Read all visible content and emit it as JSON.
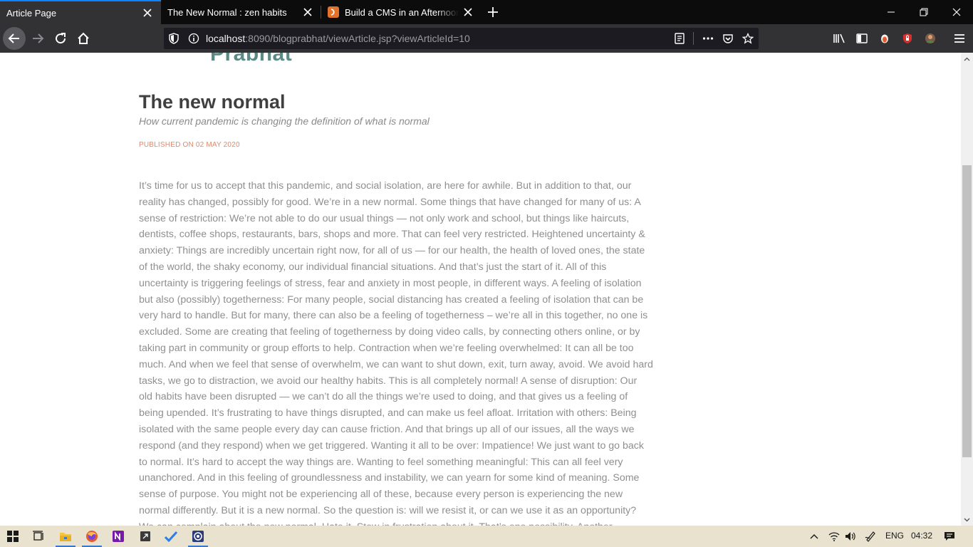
{
  "browser": {
    "tabs": [
      {
        "title": "Article Page",
        "active": true
      },
      {
        "title": "The New Normal : zen habits",
        "active": false
      },
      {
        "title": "Build a CMS in an Afternoon w",
        "active": false
      }
    ],
    "url": {
      "host": "localhost",
      "rest": ":8090/blogprabhat/viewArticle.jsp?viewArticleId=10"
    }
  },
  "page": {
    "logo_text": "Prabhat",
    "title": "The new normal",
    "subtitle": "How current pandemic is changing the definition of what is normal",
    "published": "PUBLISHED ON 02 MAY 2020",
    "body": "It’s time for us to accept that this pandemic, and social isolation, are here for awhile. But in addition to that, our reality has changed, possibly for good. We’re in a new normal. Some things that have changed for many of us: A sense of restriction: We’re not able to do our usual things — not only work and school, but things like haircuts, dentists, coffee shops, restaurants, bars, shops and more. That can feel very restricted. Heightened uncertainty & anxiety: Things are incredibly uncertain right now, for all of us — for our health, the health of loved ones, the state of the world, the shaky economy, our individual financial situations. And that’s just the start of it. All of this uncertainty is triggering feelings of stress, fear and anxiety in most people, in different ways. A feeling of isolation but also (possibly) togetherness: For many people, social distancing has created a feeling of isolation that can be very hard to handle. But for many, there can also be a feeling of togetherness – we’re all in this together, no one is excluded. Some are creating that feeling of togetherness by doing video calls, by connecting others online, or by taking part in community or group efforts to help. Contraction when we’re feeling overwhelmed: It can all be too much. And when we feel that sense of overwhelm, we can want to shut down, exit, turn away, avoid. We avoid hard tasks, we go to distraction, we avoid our healthy habits. This is all completely normal! A sense of disruption: Our old habits have been disrupted — we can’t do all the things we’re used to doing, and that gives us a feeling of being upended. It’s frustrating to have things disrupted, and can make us feel afloat. Irritation with others: Being isolated with the same people every day can cause friction. And that brings up all of our issues, all the ways we respond (and they respond) when we get triggered. Wanting it all to be over: Impatience! We just want to go back to normal. It’s hard to accept the way things are. Wanting to feel something meaningful: This can all feel very unanchored. And in this feeling of groundlessness and instability, we can yearn for some kind of meaning. Some sense of purpose. You might not be experiencing all of these, because every person is experiencing the new normal differently. But it is a new normal. So the question is: will we resist it, or can we use it as an opportunity? We can complain about the new normal. Hate it. Stew in frustration about it. That’s one possibility. Another"
  },
  "taskbar": {
    "language": "ENG",
    "time": "04:32"
  }
}
